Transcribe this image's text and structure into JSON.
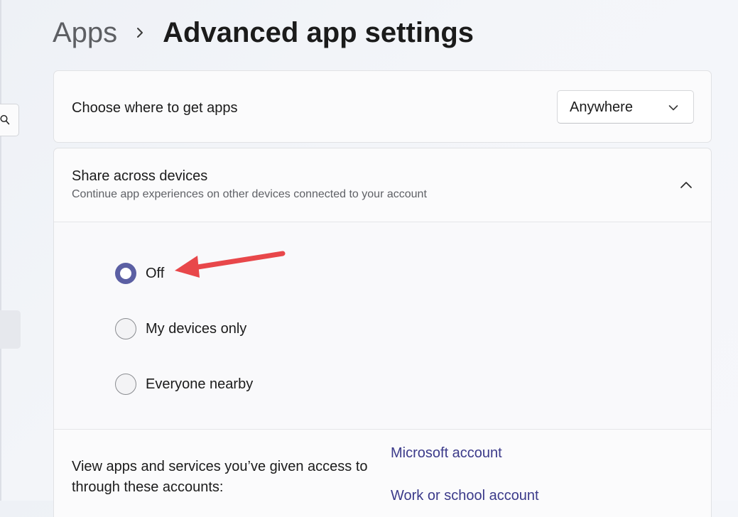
{
  "breadcrumb": {
    "parent": "Apps",
    "current": "Advanced app settings"
  },
  "get_apps": {
    "label": "Choose where to get apps",
    "selected": "Anywhere"
  },
  "share": {
    "title": "Share across devices",
    "subtitle": "Continue app experiences on other devices connected to your account",
    "options": [
      {
        "label": "Off",
        "checked": true
      },
      {
        "label": "My devices only",
        "checked": false
      },
      {
        "label": "Everyone nearby",
        "checked": false
      }
    ]
  },
  "accounts": {
    "description": "View apps and services you’ve given access to through these accounts:",
    "links": [
      "Microsoft account",
      "Work or school account"
    ]
  },
  "colors": {
    "accent": "#5b5fa3",
    "link": "#3b3a8a",
    "annotation_arrow": "#e8474a"
  }
}
